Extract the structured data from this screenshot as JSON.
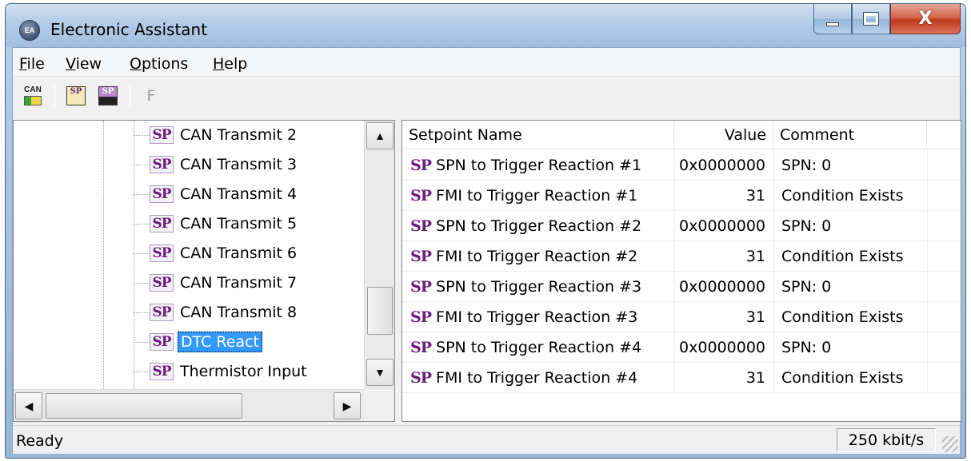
{
  "window": {
    "title": "Electronic Assistant",
    "app_icon_label": "EA",
    "caption_buttons": [
      "minimize",
      "maximize",
      "close"
    ],
    "close_glyph": "X"
  },
  "menu": {
    "file": {
      "accel": "F",
      "rest": "ile"
    },
    "view": {
      "accel": "V",
      "rest": "iew"
    },
    "options": {
      "accel": "O",
      "rest": "ptions"
    },
    "help": {
      "accel": "H",
      "rest": "elp"
    }
  },
  "toolbar": {
    "can_label": "CAN",
    "sp_open_label": "SP",
    "sp_save_label": "SP",
    "f_label": "F"
  },
  "tree": {
    "icon_label": "SP",
    "items": [
      {
        "label": "CAN Transmit 2"
      },
      {
        "label": "CAN Transmit 3"
      },
      {
        "label": "CAN Transmit 4"
      },
      {
        "label": "CAN Transmit 5"
      },
      {
        "label": "CAN Transmit 6"
      },
      {
        "label": "CAN Transmit 7"
      },
      {
        "label": "CAN Transmit 8"
      },
      {
        "label": "DTC React",
        "selected": true
      },
      {
        "label": "Thermistor Input"
      }
    ],
    "scroll_up_glyph": "▲",
    "scroll_down_glyph": "▼",
    "scroll_left_glyph": "◀",
    "scroll_right_glyph": "▶"
  },
  "list": {
    "columns": [
      "Setpoint Name",
      "Value",
      "Comment"
    ],
    "row_icon_label": "SP",
    "rows": [
      {
        "name": "SPN to Trigger Reaction #1",
        "value": "0x0000000",
        "comment": "SPN: 0"
      },
      {
        "name": "FMI to Trigger Reaction #1",
        "value": "31",
        "comment": "Condition Exists"
      },
      {
        "name": "SPN to Trigger Reaction #2",
        "value": "0x0000000",
        "comment": "SPN: 0"
      },
      {
        "name": "FMI to Trigger Reaction #2",
        "value": "31",
        "comment": "Condition Exists"
      },
      {
        "name": "SPN to Trigger Reaction #3",
        "value": "0x0000000",
        "comment": "SPN: 0"
      },
      {
        "name": "FMI to Trigger Reaction #3",
        "value": "31",
        "comment": "Condition Exists"
      },
      {
        "name": "SPN to Trigger Reaction #4",
        "value": "0x0000000",
        "comment": "SPN: 0"
      },
      {
        "name": "FMI to Trigger Reaction #4",
        "value": "31",
        "comment": "Condition Exists"
      }
    ]
  },
  "status": {
    "text": "Ready",
    "baud": "250 kbit/s"
  },
  "colors": {
    "selection": "#3399ff",
    "sp_icon": "#6a1b7a",
    "close_button": "#c0381b"
  }
}
